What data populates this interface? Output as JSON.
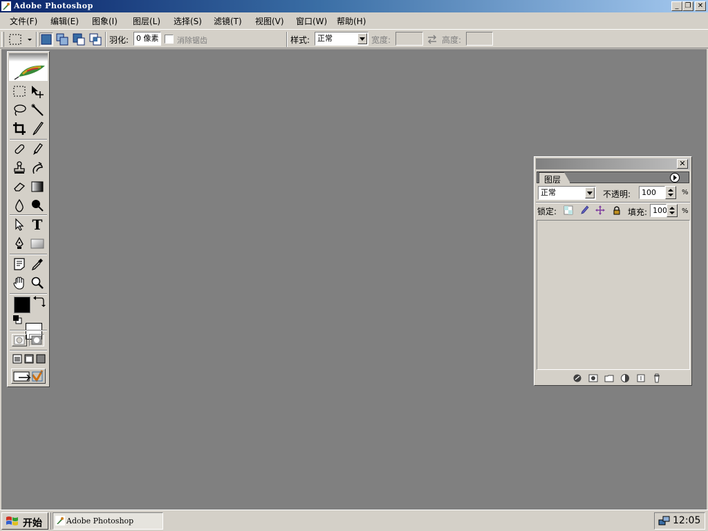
{
  "window": {
    "title": "Adobe Photoshop",
    "minimize": "_",
    "restore": "❐",
    "close": "✕"
  },
  "menu": [
    "文件(F)",
    "编辑(E)",
    "图象(I)",
    "图层(L)",
    "选择(S)",
    "滤镜(T)",
    "视图(V)",
    "窗口(W)",
    "帮助(H)"
  ],
  "options": {
    "feather_label": "羽化:",
    "feather_value": "0 像素",
    "antialias_label": "消除锯齿",
    "style_label": "样式:",
    "style_value": "正常",
    "width_label": "宽度:",
    "height_label": "高度:"
  },
  "toolbox": {
    "tools": [
      [
        "marquee-tool-icon",
        "move-tool-icon"
      ],
      [
        "lasso-tool-icon",
        "magic-wand-tool-icon"
      ],
      [
        "crop-tool-icon",
        "slice-tool-icon"
      ],
      [
        "healing-brush-tool-icon",
        "brush-tool-icon"
      ],
      [
        "clone-stamp-tool-icon",
        "history-brush-tool-icon"
      ],
      [
        "eraser-tool-icon",
        "gradient-tool-icon"
      ],
      [
        "blur-tool-icon",
        "dodge-tool-icon"
      ],
      [
        "path-selection-tool-icon",
        "type-tool-icon"
      ],
      [
        "pen-tool-icon",
        "shape-tool-icon"
      ],
      [
        "notes-tool-icon",
        "eyedropper-tool-icon"
      ],
      [
        "hand-tool-icon",
        "zoom-tool-icon"
      ]
    ],
    "foreground_color": "#000000",
    "background_color": "#ffffff",
    "type_tool_glyph": "T"
  },
  "layers_panel": {
    "tab_label": "图层",
    "blend_mode": "正常",
    "opacity_label": "不透明:",
    "opacity_value": "100",
    "opacity_unit": "%",
    "lock_label": "锁定:",
    "fill_label": "填充:",
    "fill_value": "100",
    "fill_unit": "%"
  },
  "taskbar": {
    "start_label": "开始",
    "task_label": "Adobe Photoshop",
    "clock": "12:05"
  }
}
